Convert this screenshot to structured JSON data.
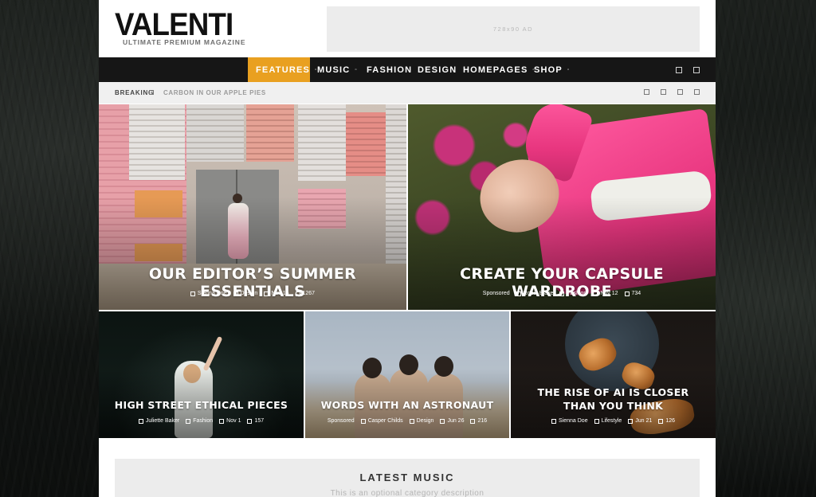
{
  "header": {
    "logo": "VALENTI",
    "tagline": "ULTIMATE PREMIUM MAGAZINE",
    "ad_text": "728x90 AD"
  },
  "nav": {
    "items": [
      {
        "label": "FEATURES",
        "has_dropdown": true,
        "active": true
      },
      {
        "label": "MUSIC",
        "has_dropdown": true
      },
      {
        "label": "FASHION",
        "has_dropdown": false
      },
      {
        "label": "DESIGN",
        "has_dropdown": false
      },
      {
        "label": "HOMEPAGES",
        "has_dropdown": true
      },
      {
        "label": "SHOP",
        "has_dropdown": true
      }
    ],
    "right_icons": [
      "search-icon",
      "cart-icon"
    ],
    "active_color": "#e9a020"
  },
  "breaking": {
    "label": "BREAKING",
    "headline": "CARBON IN OUR APPLE PIES",
    "social_icons": [
      "twitter-icon",
      "facebook-icon",
      "instagram-icon",
      "pinterest-icon"
    ]
  },
  "features": [
    {
      "title": "OUR EDITOR’S SUMMER ESSENTIALS",
      "meta": [
        "Sienna Doe",
        "Design",
        "Nov 15",
        "1267"
      ]
    },
    {
      "title": "CREATE YOUR CAPSULE WARDROBE",
      "meta": [
        "Sponsored",
        "Robin Blake",
        "Fashion",
        "Nov 12",
        "734"
      ]
    },
    {
      "title": "HIGH STREET ETHICAL PIECES",
      "meta": [
        "Juliette Baker",
        "Fashion",
        "Nov 1",
        "157"
      ]
    },
    {
      "title": "WORDS WITH AN ASTRONAUT",
      "meta": [
        "Sponsored",
        "Casper Childs",
        "Design",
        "Jun 26",
        "216"
      ]
    },
    {
      "title": "THE RISE OF AI IS CLOSER THAN YOU THINK",
      "meta": [
        "Sienna Doe",
        "Lifestyle",
        "Jun 21",
        "126"
      ]
    }
  ],
  "latest": {
    "title": "LATEST MUSIC",
    "description": "This is an optional category description"
  }
}
